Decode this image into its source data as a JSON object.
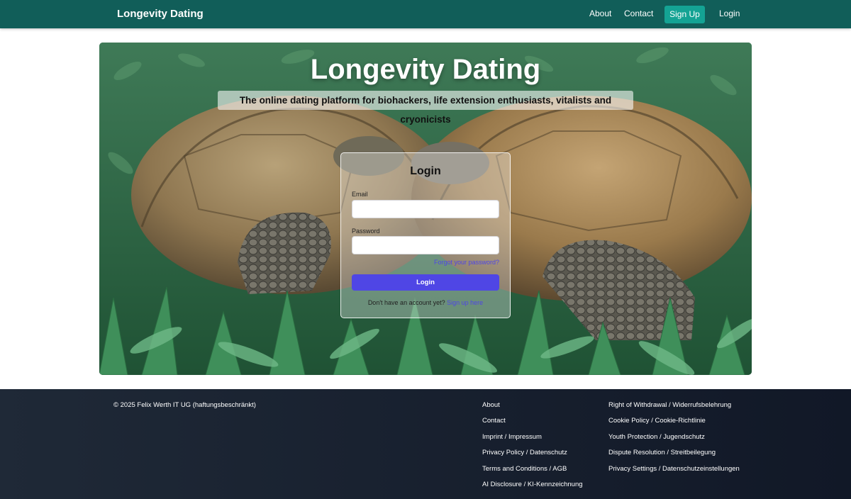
{
  "header": {
    "brand": "Longevity Dating",
    "nav": {
      "about": "About",
      "contact": "Contact",
      "signup": "Sign Up",
      "login": "Login"
    }
  },
  "hero": {
    "title": "Longevity Dating",
    "subtitle": "The online dating platform for biohackers, life extension enthusiasts, vitalists and cryonicists"
  },
  "login_form": {
    "title": "Login",
    "email_label": "Email",
    "email_value": "",
    "password_label": "Password",
    "password_value": "",
    "forgot_link": "Forgot your password?",
    "submit_label": "Login",
    "signup_prompt": "Don't have an account yet?",
    "signup_link": "Sign up here"
  },
  "footer": {
    "copyright": "© 2025 Felix Werth IT UG (haftungsbeschränkt)",
    "links_col1": [
      "About",
      "Contact",
      "Imprint / Impressum",
      "Privacy Policy / Datenschutz",
      "Terms and Conditions / AGB",
      "AI Disclosure / KI-Kennzeichnung"
    ],
    "links_col2": [
      "Right of Withdrawal / Widerrufsbelehrung",
      "Cookie Policy / Cookie-Richtlinie",
      "Youth Protection / Jugendschutz",
      "Dispute Resolution / Streitbeilegung",
      "Privacy Settings / Datenschutzeinstellungen"
    ]
  },
  "colors": {
    "header_bg": "#115e59",
    "signup_bg": "#14a394",
    "accent": "#4f46e5",
    "footer_bg": "#1f2937"
  }
}
